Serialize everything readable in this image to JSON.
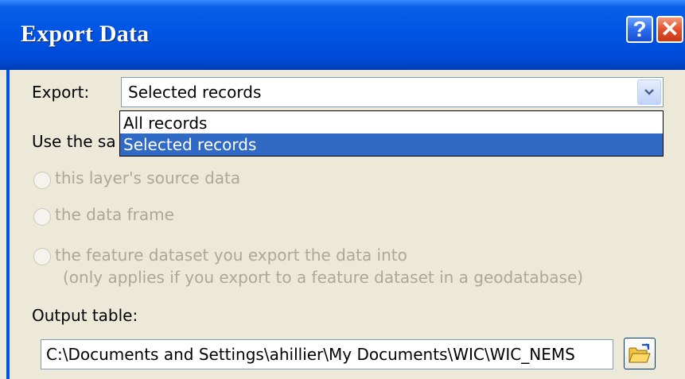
{
  "window": {
    "title": "Export Data",
    "help_glyph": "?",
    "close_glyph": "✕"
  },
  "export": {
    "label": "Export:",
    "selected": "Selected records",
    "options": [
      "All records",
      "Selected records"
    ]
  },
  "coordinate_system": {
    "label_partial": "Use the sa",
    "options": [
      {
        "label": "this layer's source data",
        "enabled": false
      },
      {
        "label": "the data frame",
        "enabled": false
      },
      {
        "label": "the feature dataset you export the data into",
        "note": "(only applies if you export to a feature dataset in a geodatabase)",
        "enabled": false
      }
    ]
  },
  "output": {
    "label": "Output table:",
    "value": "C:\\Documents and Settings\\ahillier\\My Documents\\WIC\\WIC_NEMS",
    "browse_icon": "open-folder-icon"
  },
  "colors": {
    "title_bar": "#0055e5",
    "selection": "#316ac5",
    "close": "#e2512c"
  }
}
